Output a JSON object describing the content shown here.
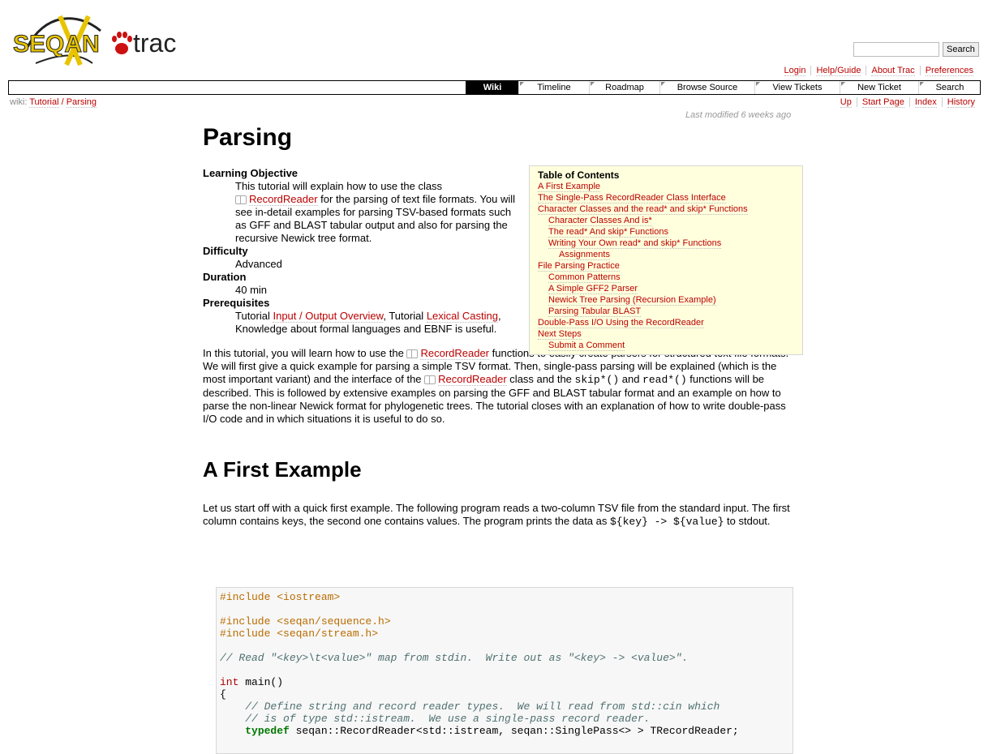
{
  "logo": {
    "text_left": "SEQAN",
    "text_right": "trac"
  },
  "search": {
    "button": "Search",
    "value": ""
  },
  "metanav": [
    "Login",
    "Help/Guide",
    "About Trac",
    "Preferences"
  ],
  "mainnav": [
    "Wiki",
    "Timeline",
    "Roadmap",
    "Browse Source",
    "View Tickets",
    "New Ticket",
    "Search"
  ],
  "pagepath": {
    "prefix": "wiki:",
    "crumb1": "Tutorial",
    "sep": "/",
    "crumb2": "Parsing"
  },
  "ctxtnav": [
    "Up",
    "Start Page",
    "Index",
    "History"
  ],
  "last_modified": "Last modified 6 weeks ago",
  "title": "Parsing",
  "toc": {
    "title": "Table of Contents",
    "items": [
      {
        "level": 1,
        "text": "A First Example"
      },
      {
        "level": 1,
        "text": "The Single-Pass RecordReader Class Interface"
      },
      {
        "level": 1,
        "text": "Character Classes and the read* and skip* Functions"
      },
      {
        "level": 2,
        "text": "Character Classes And is*"
      },
      {
        "level": 2,
        "text": "The read* And skip* Functions"
      },
      {
        "level": 2,
        "text": "Writing Your Own read* and skip* Functions"
      },
      {
        "level": 3,
        "text": "Assignments"
      },
      {
        "level": 1,
        "text": "File Parsing Practice"
      },
      {
        "level": 2,
        "text": "Common Patterns"
      },
      {
        "level": 2,
        "text": "A Simple GFF2 Parser"
      },
      {
        "level": 2,
        "text": "Newick Tree Parsing (Recursion Example)"
      },
      {
        "level": 2,
        "text": "Parsing Tabular BLAST"
      },
      {
        "level": 1,
        "text": "Double-Pass I/O Using the RecordReader"
      },
      {
        "level": 1,
        "text": "Next Steps"
      },
      {
        "level": 2,
        "text": "Submit a Comment"
      }
    ]
  },
  "meta": {
    "lo_label": "Learning Objective",
    "lo_text1": "This tutorial will explain how to use the class",
    "lo_link": "RecordReader",
    "lo_text2": " for the parsing of text file formats. You will see in-detail examples for parsing TSV-based formats such as GFF and BLAST tabular output and also for parsing the recursive Newick tree format.",
    "difficulty_label": "Difficulty",
    "difficulty": "Advanced",
    "duration_label": "Duration",
    "duration": "40 min",
    "prereq_label": "Prerequisites",
    "prereq_t1": "Tutorial ",
    "prereq_link1": "Input / Output Overview",
    "prereq_t2": ", Tutorial ",
    "prereq_link2": "Lexical Casting",
    "prereq_t3": ", Knowledge about formal languages and EBNF is useful."
  },
  "intro": {
    "t1": "In this tutorial, you will learn how to use the ",
    "link1": "RecordReader",
    "t2": " functions to easily create parsers for structured text file formats. We will first give a quick example for parsing a simple TSV format. Then, single-pass parsing will be explained (which is the most important variant) and the interface of the ",
    "link2": "RecordReader",
    "t3": " class and the ",
    "code1": "skip*()",
    "t4": " and ",
    "code2": "read*()",
    "t5": " functions will be described. This is followed by extensive examples on parsing the GFF and BLAST tabular format and an example on how to parse the non-linear Newick format for phylogenetic trees. The tutorial closes with an explanation of how to write double-pass I/O code and in which situations it is useful to do so."
  },
  "section1": {
    "title": "A First Example",
    "p1": "Let us start off with a quick first example. The following program reads a two-column TSV file from the standard input. The first column contains keys, the second one contains values. The program prints the data as ",
    "p1code": "${key} -> ${value}",
    "p1end": " to stdout."
  },
  "code": {
    "l1": "#include <iostream>",
    "l2": "#include <seqan/sequence.h>",
    "l3": "#include <seqan/stream.h>",
    "l4": "// Read \"<key>\\t<value>\" map from stdin.  Write out as \"<key> -> <value>\".",
    "l5kw": "int",
    "l5": " main()",
    "l6": "{",
    "l7": "    // Define string and record reader types.  We will read from std::cin which",
    "l8": "    // is of type std::istream.  We use a single-pass record reader.",
    "l9kw": "typedef",
    "l9": " seqan::RecordReader<std::istream, seqan::SinglePass<> > TRecordReader;"
  }
}
